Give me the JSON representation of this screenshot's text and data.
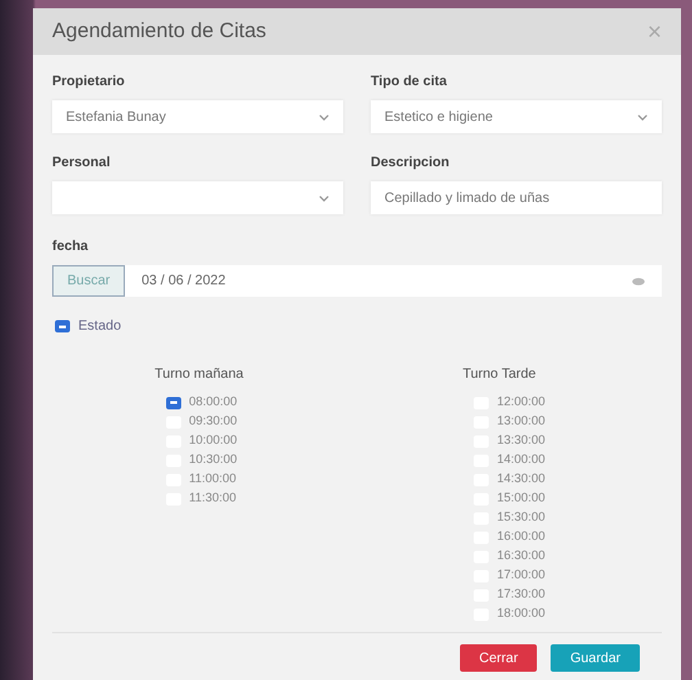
{
  "dialog": {
    "title": "Agendamiento de Citas",
    "close": "×"
  },
  "fields": [
    {
      "kind": "select",
      "label": "Propietario",
      "value": "Estefania Bunay"
    },
    {
      "kind": "select",
      "label": "Tipo de cita",
      "value": "Estetico e higiene"
    },
    {
      "kind": "select",
      "label": "Personal"
    },
    {
      "kind": "text",
      "label": "Descripcion",
      "value": "Cepillado y limado de uñas"
    }
  ],
  "date": {
    "label": "fecha",
    "button": "Buscar",
    "value": "03 / 06 / 2022"
  },
  "estado": {
    "label": "Estado",
    "checked": true
  },
  "shifts": [
    {
      "title": "Turno mañana",
      "slots": [
        {
          "time": "08:00:00",
          "checked": true
        },
        {
          "time": "09:30:00",
          "checked": false
        },
        {
          "time": "10:00:00",
          "checked": false
        },
        {
          "time": "10:30:00",
          "checked": false
        },
        {
          "time": "11:00:00",
          "checked": false
        },
        {
          "time": "11:30:00",
          "checked": false
        }
      ]
    },
    {
      "title": "Turno Tarde",
      "slots": [
        {
          "time": "12:00:00",
          "checked": false
        },
        {
          "time": "13:00:00",
          "checked": false
        },
        {
          "time": "13:30:00",
          "checked": false
        },
        {
          "time": "14:00:00",
          "checked": false
        },
        {
          "time": "14:30:00",
          "checked": false
        },
        {
          "time": "15:00:00",
          "checked": false
        },
        {
          "time": "15:30:00",
          "checked": false
        },
        {
          "time": "16:00:00",
          "checked": false
        },
        {
          "time": "16:30:00",
          "checked": false
        },
        {
          "time": "17:00:00",
          "checked": false
        },
        {
          "time": "17:30:00",
          "checked": false
        },
        {
          "time": "18:00:00",
          "checked": false
        }
      ]
    }
  ],
  "buttons": [
    {
      "kind": "danger",
      "label": "Cerrar"
    },
    {
      "kind": "primary",
      "label": "Guardar"
    }
  ]
}
